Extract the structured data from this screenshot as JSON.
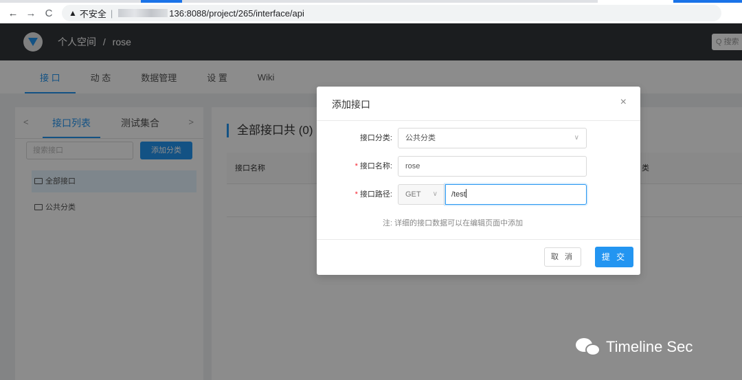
{
  "browser": {
    "back": "←",
    "forward": "→",
    "reload": "C",
    "warning_glyph": "▲",
    "insecure_label": "不安全",
    "separator": "|",
    "url_visible": "136:8088/project/265/interface/api"
  },
  "topnav": {
    "breadcrumb_space": "个人空间",
    "breadcrumb_sep": "/",
    "breadcrumb_project": "rose",
    "search_placeholder": "Q 搜索"
  },
  "subnav": {
    "tabs": [
      {
        "label": "接 口",
        "active": true
      },
      {
        "label": "动 态",
        "active": false
      },
      {
        "label": "数据管理",
        "active": false
      },
      {
        "label": "设 置",
        "active": false
      },
      {
        "label": "Wiki",
        "active": false
      }
    ]
  },
  "sidebar": {
    "arrow_left": "<",
    "arrow_right": ">",
    "tab_list": "接口列表",
    "tab_collection": "测试集合",
    "search_placeholder": "搜索接口",
    "add_category": "添加分类",
    "tree": [
      {
        "label": "全部接口",
        "selected": true
      },
      {
        "label": "公共分类",
        "selected": false
      }
    ]
  },
  "main": {
    "title": "全部接口共 (0) 个",
    "col_name": "接口名称",
    "col_tail": "类"
  },
  "modal": {
    "title": "添加接口",
    "close": "×",
    "category_label": "接口分类:",
    "category_value": "公共分类",
    "name_label": "接口名称:",
    "name_value": "rose",
    "path_label": "接口路径:",
    "method_value": "GET",
    "path_value": "/test",
    "required_mark": "*",
    "chevron": "∨",
    "note": "注: 详细的接口数据可以在编辑页面中添加",
    "cancel": "取 消",
    "submit": "提 交"
  },
  "watermark": {
    "text": "Timeline Sec"
  },
  "colors": {
    "primary": "#2395f1",
    "topnav_bg": "#32363a",
    "required": "#f5222d"
  }
}
